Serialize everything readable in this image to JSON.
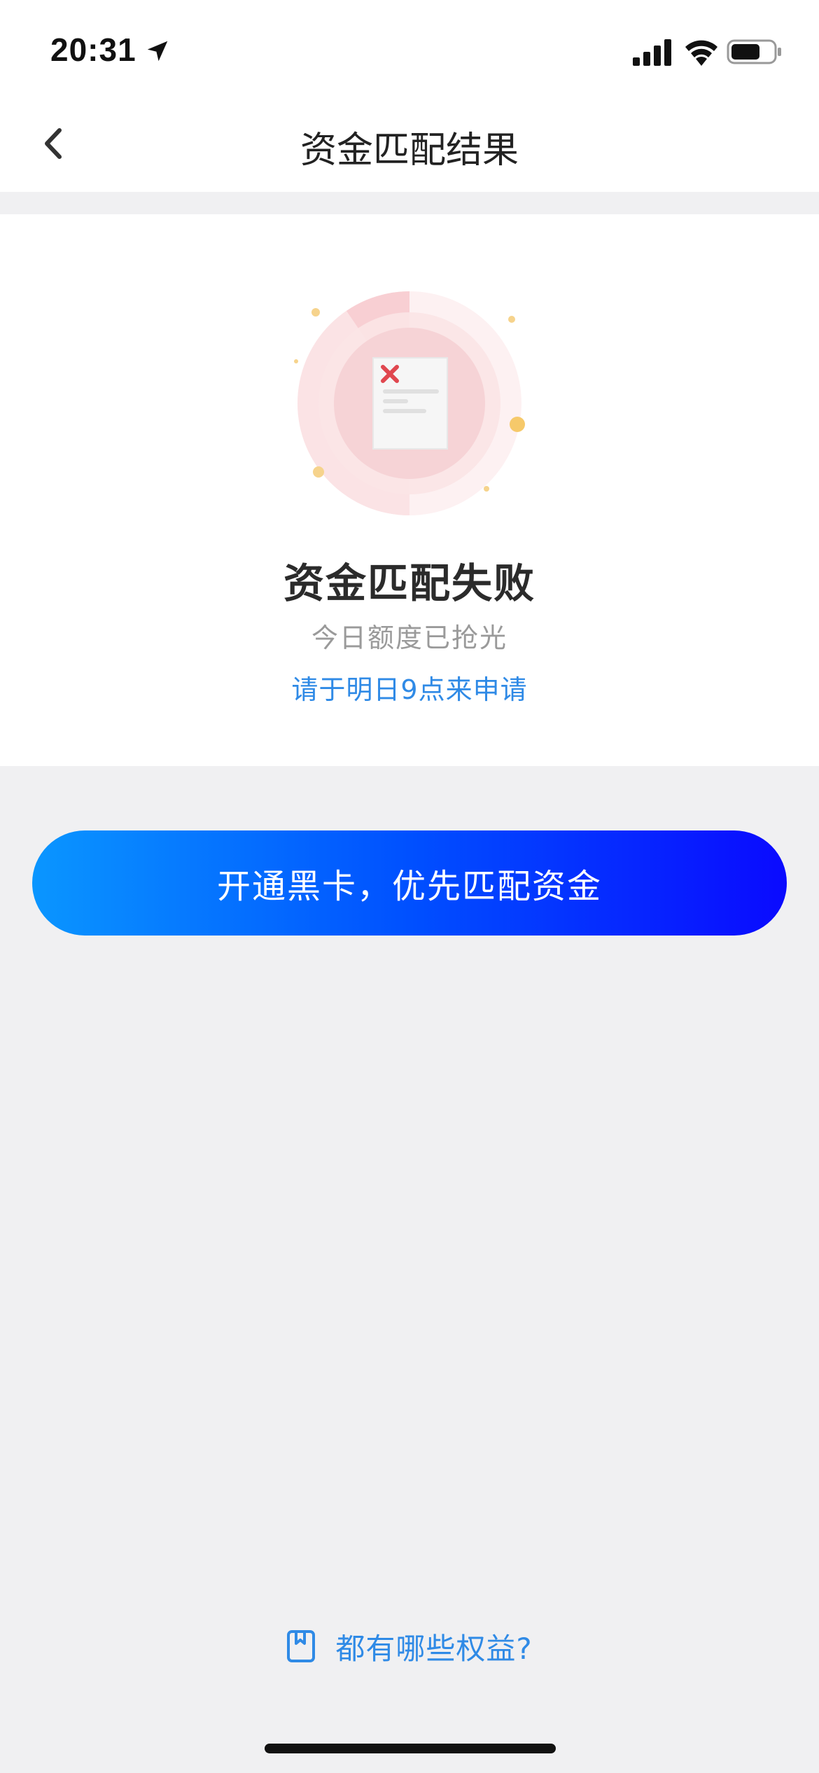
{
  "status_bar": {
    "time": "20:31"
  },
  "nav": {
    "title": "资金匹配结果"
  },
  "result": {
    "title": "资金匹配失败",
    "subtitle": "今日额度已抢光",
    "hint": "请于明日9点来申请"
  },
  "cta": {
    "label": "开通黑卡，优先匹配资金"
  },
  "footer": {
    "benefits_link": "都有哪些权益?"
  },
  "colors": {
    "accent_blue": "#2f8ae6",
    "cta_gradient_start": "#0a96ff",
    "cta_gradient_end": "#0a0aff",
    "error_red": "#e0474f",
    "background": "#f0f0f2"
  },
  "icons": {
    "status": [
      "location-arrow-icon",
      "signal-icon",
      "wifi-icon",
      "battery-icon"
    ],
    "nav_back": "chevron-left-icon",
    "result": "failed-document-icon",
    "benefits": "bookmark-icon"
  }
}
